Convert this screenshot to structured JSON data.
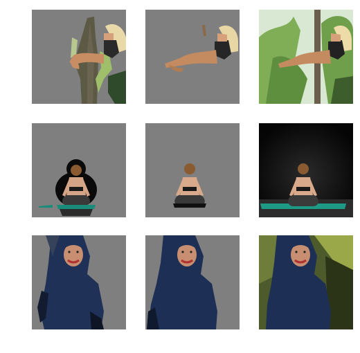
{
  "figure": {
    "rows": [
      {
        "subject": "pole-dancer",
        "tiles": [
          {
            "variant": "masked-coarse",
            "background": "#7f7f7f"
          },
          {
            "variant": "masked-fine",
            "background": "#7f7f7f"
          },
          {
            "variant": "original",
            "background": "#cfe3c7"
          }
        ]
      },
      {
        "subject": "yoga-meditation",
        "tiles": [
          {
            "variant": "masked-coarse",
            "background": "#7f7f7f"
          },
          {
            "variant": "masked-fine",
            "background": "#7f7f7f"
          },
          {
            "variant": "original",
            "background": "#0e0e0e"
          }
        ]
      },
      {
        "subject": "woman-in-hijab",
        "tiles": [
          {
            "variant": "masked-coarse",
            "background": "#7f7f7f"
          },
          {
            "variant": "masked-fine",
            "background": "#7f7f7f"
          },
          {
            "variant": "original",
            "background": "#5f6a34"
          }
        ]
      }
    ]
  }
}
